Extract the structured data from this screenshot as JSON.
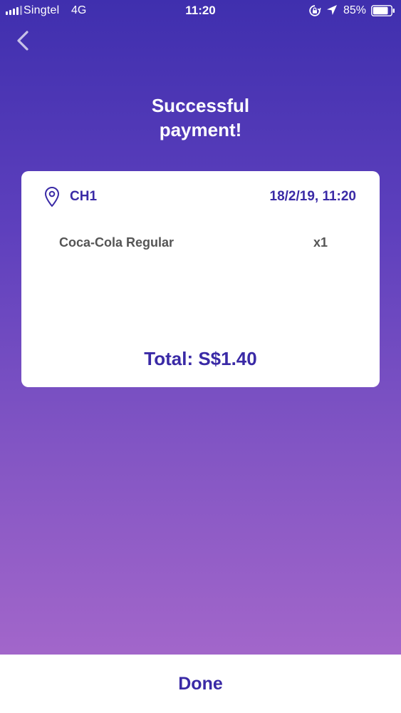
{
  "status_bar": {
    "carrier": "Singtel",
    "network": "4G",
    "time": "11:20",
    "battery_percent": "85%",
    "battery_level": 0.85,
    "signal_bars": 4,
    "icons": [
      "signal-icon",
      "lock-rotation-icon",
      "location-arrow-icon",
      "battery-icon"
    ]
  },
  "nav": {
    "back_icon": "chevron-left-icon"
  },
  "header": {
    "title_line1": "Successful",
    "title_line2": "payment!"
  },
  "receipt": {
    "location_icon": "map-pin-icon",
    "location": "CH1",
    "datetime": "18/2/19, 11:20",
    "items": [
      {
        "name": "Coca-Cola Regular",
        "quantity": "x1"
      }
    ],
    "total": "Total: S$1.40"
  },
  "footer": {
    "done_label": "Done"
  },
  "colors": {
    "gradient_top": "#3f2fae",
    "gradient_bottom": "#a266ca",
    "accent": "#3a2aa6",
    "item_text": "#555555",
    "card": "#ffffff"
  }
}
